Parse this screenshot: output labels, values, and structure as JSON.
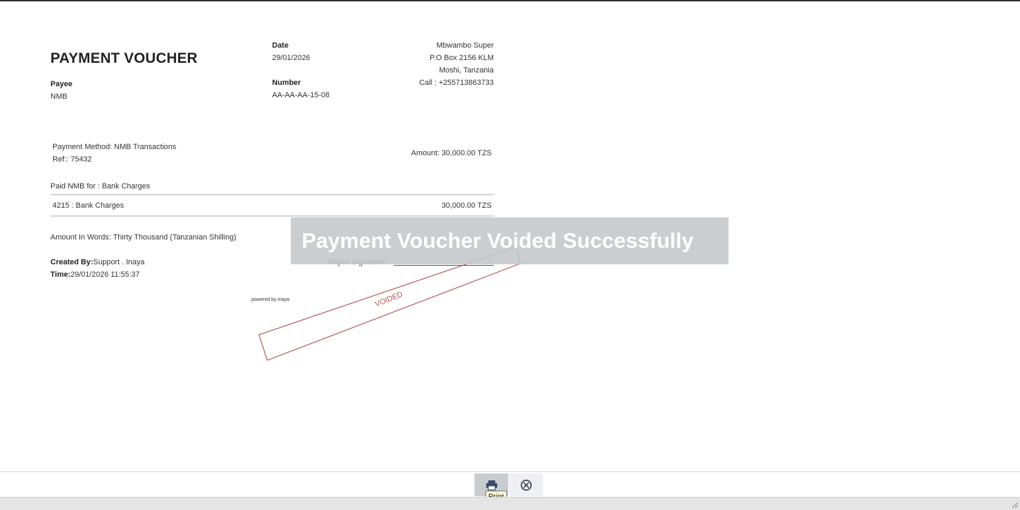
{
  "voucher": {
    "title": "PAYMENT VOUCHER",
    "payee_label": "Payee",
    "payee_value": "NMB",
    "date_label": "Date",
    "date_value": "29/01/2026",
    "number_label": "Number",
    "number_value": "AA-AA-AA-15-08",
    "company": {
      "name": "Mbwambo Super",
      "address1": "P.O Box 2156 KLM",
      "address2": "Moshi, Tanzania",
      "phone": "Call : +255713863733"
    },
    "payment_method": "Payment Method: NMB Transactions",
    "ref": "Ref:: 75432",
    "amount": "Amount: 30,000.00 TZS",
    "paid_for": "Paid NMB for : Bank Charges",
    "line_item": {
      "account": "4215 : Bank Charges",
      "amount": "30,000.00 TZS"
    },
    "amount_in_words": "Amount In Words: Thirty Thousand (Tanzanian Shilling)",
    "created_by_label": "Created By:",
    "created_by_value": "Support . Inaya",
    "time_label": "Time:",
    "time_value": "29/01/2026 11:55:37",
    "payee_signature": "Payee Signature:",
    "powered_by": "powered by inaya",
    "stamp_text": "VOIDED"
  },
  "toast": {
    "message": "Payment Voucher Voided Successfully"
  },
  "toolbar": {
    "print_tooltip": "Print"
  },
  "colors": {
    "stamp": "#b5554f",
    "toast_bg": "#c4c7ca",
    "print_button_bg": "#c8ccd1",
    "tooltip_bg": "#fffbd2"
  }
}
